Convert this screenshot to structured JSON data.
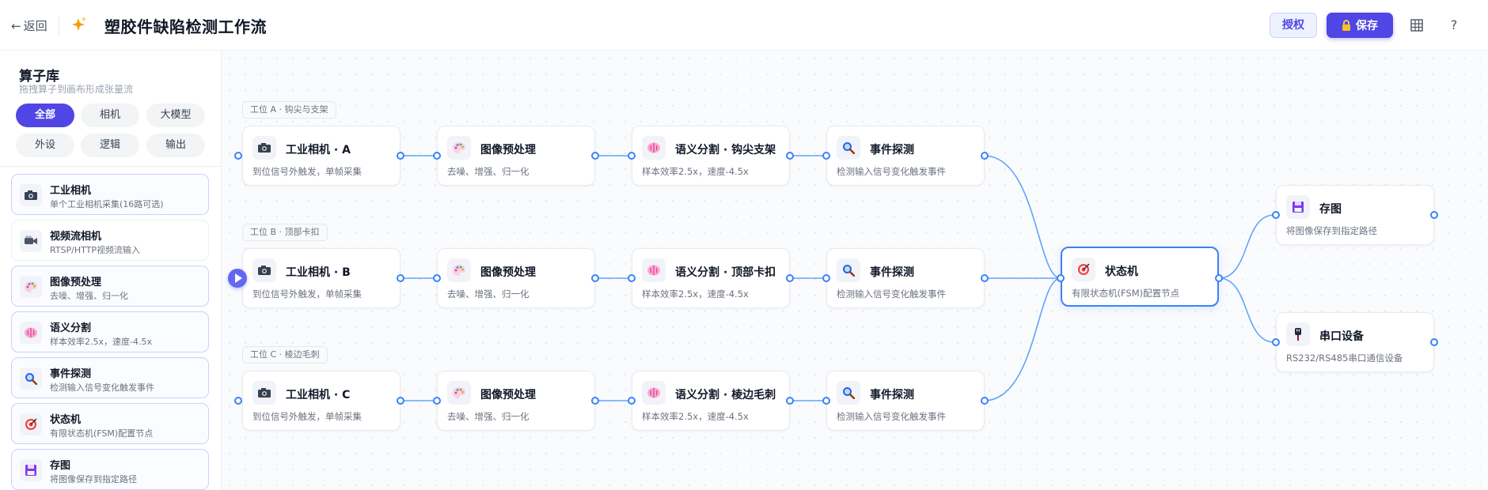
{
  "topbar": {
    "back_label": "返回",
    "title": "塑胶件缺陷检测工作流",
    "auth_label": "授权",
    "save_label": "保存",
    "icons": [
      "sparkle-icon",
      "lock-icon",
      "grid-icon",
      "help-icon"
    ],
    "help_glyph": "?"
  },
  "colors": {
    "accent": "#4f46e5",
    "edge": "#60a5fa",
    "port": "#3b82f6",
    "fsm_border": "#3b82f6"
  },
  "sidebar": {
    "title": "算子库",
    "subtitle": "拖拽算子到画布形成张量流",
    "filters": [
      {
        "label": "全部",
        "active": true
      },
      {
        "label": "相机",
        "active": false
      },
      {
        "label": "大模型",
        "active": false
      },
      {
        "label": "外设",
        "active": false
      },
      {
        "label": "逻辑",
        "active": false
      },
      {
        "label": "输出",
        "active": false
      }
    ],
    "operators": [
      {
        "name": "工业相机",
        "desc": "单个工业相机采集(16路可选)",
        "icon": "camera-icon"
      },
      {
        "name": "视频流相机",
        "desc": "RTSP/HTTP视频流输入",
        "icon": "video-camera-icon"
      },
      {
        "name": "图像预处理",
        "desc": "去噪、增强、归一化",
        "icon": "palette-icon"
      },
      {
        "name": "语义分割",
        "desc": "样本效率2.5x，速度-4.5x",
        "icon": "brain-icon"
      },
      {
        "name": "事件探测",
        "desc": "检测输入信号变化触发事件",
        "icon": "magnifier-icon"
      },
      {
        "name": "状态机",
        "desc": "有限状态机(FSM)配置节点",
        "icon": "target-icon"
      },
      {
        "name": "存图",
        "desc": "将图像保存到指定路径",
        "icon": "floppy-disk-icon"
      }
    ]
  },
  "canvas": {
    "lanes": [
      {
        "label": "工位 A · 钩尖与支架",
        "nodes": [
          {
            "title": "工业相机 · A",
            "desc": "到位信号外触发，单帧采集",
            "icon": "camera-icon"
          },
          {
            "title": "图像预处理",
            "desc": "去噪、增强、归一化",
            "icon": "palette-icon"
          },
          {
            "title": "语义分割 · 钩尖支架",
            "desc": "样本效率2.5x，速度-4.5x",
            "icon": "brain-icon"
          },
          {
            "title": "事件探测",
            "desc": "检测输入信号变化触发事件",
            "icon": "magnifier-icon"
          }
        ]
      },
      {
        "label": "工位 B · 顶部卡扣",
        "nodes": [
          {
            "title": "工业相机 · B",
            "desc": "到位信号外触发，单帧采集",
            "icon": "camera-icon"
          },
          {
            "title": "图像预处理",
            "desc": "去噪、增强、归一化",
            "icon": "palette-icon"
          },
          {
            "title": "语义分割 · 顶部卡扣",
            "desc": "样本效率2.5x，速度-4.5x",
            "icon": "brain-icon"
          },
          {
            "title": "事件探测",
            "desc": "检测输入信号变化触发事件",
            "icon": "magnifier-icon"
          }
        ]
      },
      {
        "label": "工位 C · 棱边毛刺",
        "nodes": [
          {
            "title": "工业相机 · C",
            "desc": "到位信号外触发，单帧采集",
            "icon": "camera-icon"
          },
          {
            "title": "图像预处理",
            "desc": "去噪、增强、归一化",
            "icon": "palette-icon"
          },
          {
            "title": "语义分割 · 棱边毛刺",
            "desc": "样本效率2.5x，速度-4.5x",
            "icon": "brain-icon"
          },
          {
            "title": "事件探测",
            "desc": "检测输入信号变化触发事件",
            "icon": "magnifier-icon"
          }
        ]
      }
    ],
    "fsm": {
      "title": "状态机",
      "desc": "有限状态机(FSM)配置节点",
      "icon": "target-icon"
    },
    "outputs": [
      {
        "title": "存图",
        "desc": "将图像保存到指定路径",
        "icon": "floppy-disk-icon"
      },
      {
        "title": "串口设备",
        "desc": "RS232/RS485串口通信设备",
        "icon": "serial-plug-icon"
      }
    ]
  }
}
